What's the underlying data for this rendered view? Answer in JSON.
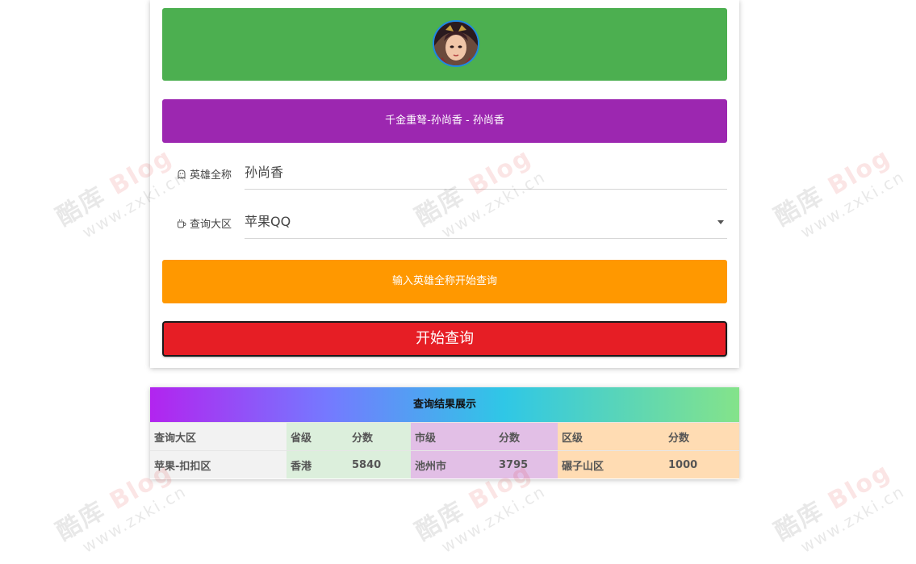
{
  "hero": {
    "avatar_icon": "hero-avatar",
    "title": "千金重弩-孙尚香 - 孙尚香"
  },
  "form": {
    "name_label": "英雄全称",
    "name_value": "孙尚香",
    "region_label": "查询大区",
    "region_value": "苹果QQ"
  },
  "hint": "输入英雄全称开始查询",
  "query_button": "开始查询",
  "results": {
    "title": "查询结果展示",
    "headers": [
      "查询大区",
      "省级",
      "分数",
      "市级",
      "分数",
      "区级",
      "分数"
    ],
    "row": [
      "苹果-扣扣区",
      "香港",
      "5840",
      "池州市",
      "3795",
      "碾子山区",
      "1000"
    ]
  },
  "watermark": {
    "brand": "酷库",
    "blog": "Blog",
    "url": "www.zxki.cn"
  },
  "colors": {
    "banner": "#4caf50",
    "title_bar": "#9c27b0",
    "hint_bar": "#ff9800",
    "query_button": "#e61e25"
  }
}
